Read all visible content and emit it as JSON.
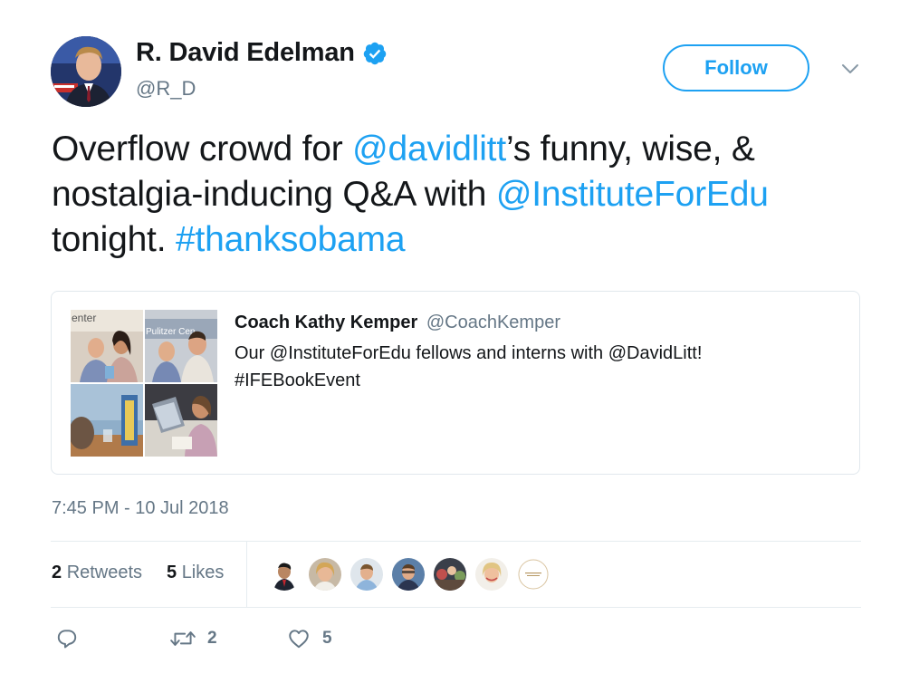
{
  "author": {
    "display_name": "R. David Edelman",
    "handle": "@R_D",
    "verified_icon": "verified-badge-icon"
  },
  "follow_label": "Follow",
  "tweet": {
    "mention1": "@davidlitt",
    "text1": "’s funny, wise, & nostalgia-inducing Q&A with ",
    "prefix": "Overflow crowd for ",
    "mention2": "@InstituteForEdu",
    "text2": " tonight. ",
    "hashtag": "#thanksobama"
  },
  "quoted_tweet": {
    "name": "Coach Kathy Kemper",
    "handle": "@CoachKemper",
    "line1": "Our @InstituteForEdu fellows and interns with @DavidLitt!",
    "line2": "#IFEBookEvent",
    "photo_texts": [
      "enter",
      "Pulitzer Cen"
    ]
  },
  "timestamp": "7:45 PM - 10 Jul 2018",
  "stats": {
    "retweets_count": "2",
    "retweets_label": "Retweets",
    "likes_count": "5",
    "likes_label": "Likes"
  },
  "actions": {
    "reply_icon": "reply-icon",
    "retweet_icon": "retweet-icon",
    "retweet_count": "2",
    "like_icon": "heart-icon",
    "like_count": "5"
  },
  "colors": {
    "link": "#1da1f2",
    "text": "#14171a",
    "secondary": "#657786",
    "border": "#e1e8ed"
  }
}
